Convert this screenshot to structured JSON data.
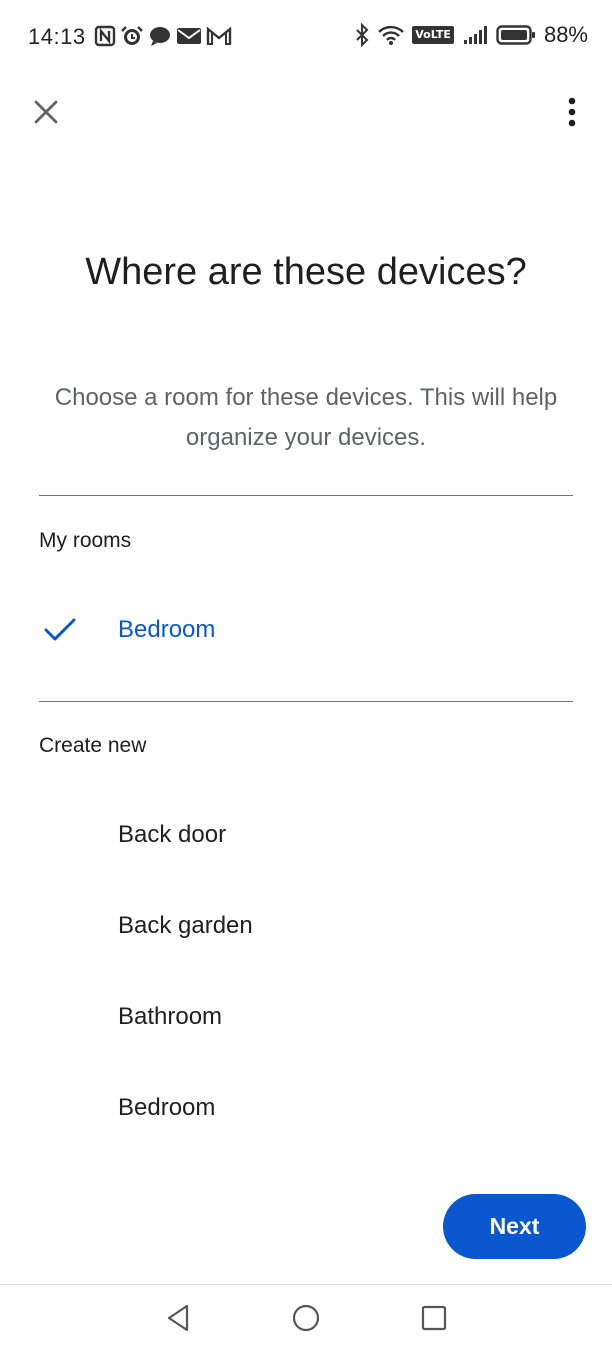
{
  "status_bar": {
    "time": "14:13",
    "battery": "88%",
    "volte": "VoLTE",
    "left_icons": [
      "nfc-icon",
      "alarm-icon",
      "chat-icon",
      "mail-icon",
      "gmail-icon"
    ],
    "right_icons": [
      "bluetooth-icon",
      "wifi-icon",
      "volte-icon",
      "signal-icon",
      "battery-icon"
    ]
  },
  "toolbar": {
    "close_icon": "close-icon",
    "more_icon": "more-vert-icon"
  },
  "header": {
    "title": "Where are these devices?",
    "subtitle": "Choose a room for these devices. This will help organize your devices."
  },
  "my_rooms": {
    "label": "My rooms",
    "items": [
      {
        "label": "Bedroom",
        "selected": true
      }
    ]
  },
  "create_new": {
    "label": "Create new",
    "items": [
      {
        "label": "Back door"
      },
      {
        "label": "Back garden"
      },
      {
        "label": "Bathroom"
      },
      {
        "label": "Bedroom"
      }
    ]
  },
  "actions": {
    "next_label": "Next"
  },
  "colors": {
    "accent": "#0b57d0",
    "text": "#1f1f1f",
    "secondary_text": "#5f6368"
  },
  "nav_bar": {
    "buttons": [
      "back-icon",
      "home-icon",
      "recents-icon"
    ]
  }
}
